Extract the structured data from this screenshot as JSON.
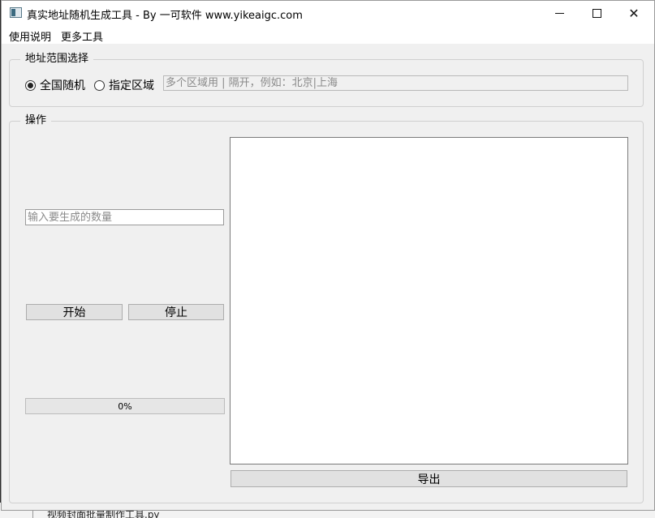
{
  "window": {
    "title": "真实地址随机生成工具 - By 一可软件 www.yikeaigc.com"
  },
  "menu": {
    "items": [
      "使用说明",
      "更多工具"
    ]
  },
  "address_group": {
    "title": "地址范围选择",
    "radio_all": {
      "label": "全国随机",
      "checked": true
    },
    "radio_region": {
      "label": "指定区域",
      "checked": false
    },
    "region_input": {
      "placeholder": "多个区域用 | 隔开，例如：北京|上海",
      "value": ""
    }
  },
  "operation_group": {
    "title": "操作",
    "count_input": {
      "placeholder": "输入要生成的数量",
      "value": ""
    },
    "start_label": "开始",
    "stop_label": "停止",
    "progress": {
      "value": 0,
      "text": "0%"
    },
    "output_text": "",
    "export_label": "导出"
  },
  "background": {
    "file_name": "视频封面批量制作工具.py"
  },
  "colors": {
    "progress_fill": "#06b025",
    "window_bg": "#f0f0f0"
  }
}
